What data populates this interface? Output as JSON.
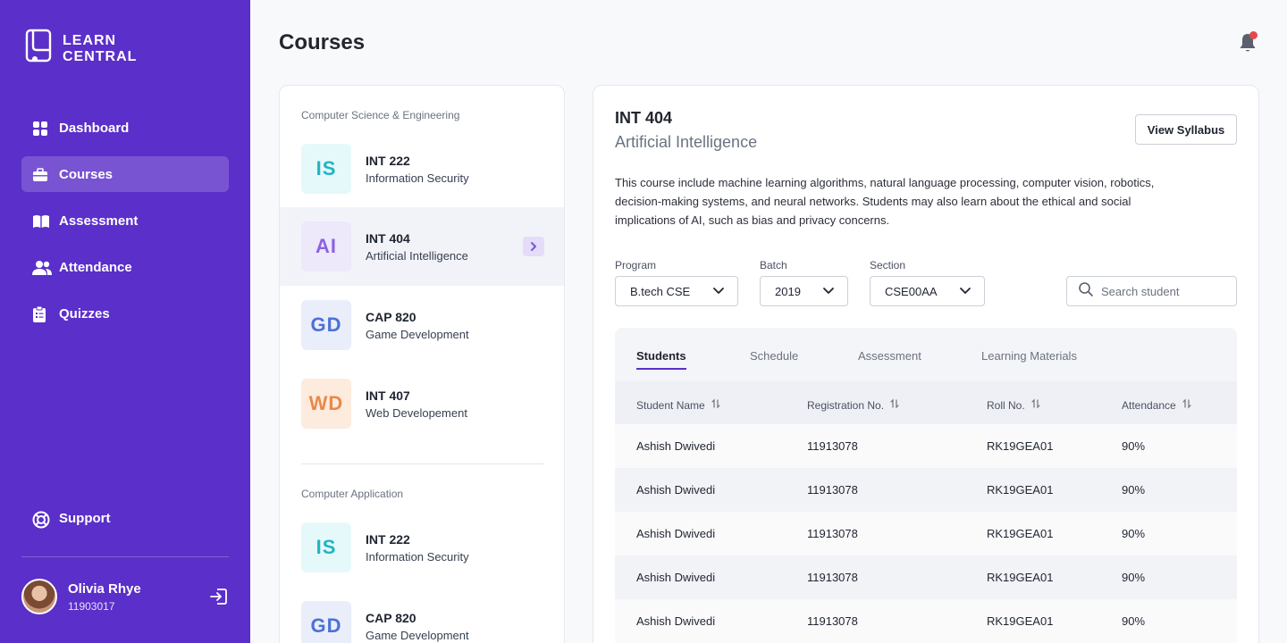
{
  "brand": {
    "line1": "LEARN",
    "line2": "CENTRAL"
  },
  "nav": [
    {
      "label": "Dashboard",
      "icon": "grid-icon"
    },
    {
      "label": "Courses",
      "icon": "briefcase-icon",
      "active": true
    },
    {
      "label": "Assessment",
      "icon": "book-open-icon"
    },
    {
      "label": "Attendance",
      "icon": "users-icon"
    },
    {
      "label": "Quizzes",
      "icon": "clipboard-icon"
    }
  ],
  "support": {
    "label": "Support",
    "icon": "life-buoy-icon"
  },
  "user": {
    "name": "Olivia Rhye",
    "id": "11903017"
  },
  "header": {
    "title": "Courses"
  },
  "course_groups": [
    {
      "label": "Computer Science & Engineering",
      "courses": [
        {
          "badge": "IS",
          "code": "INT 222",
          "name": "Information Security"
        },
        {
          "badge": "AI",
          "code": "INT 404",
          "name": "Artificial Intelligence",
          "selected": true
        },
        {
          "badge": "GD",
          "code": "CAP 820",
          "name": "Game Development"
        },
        {
          "badge": "WD",
          "code": "INT 407",
          "name": "Web Developement"
        }
      ]
    },
    {
      "label": "Computer Application",
      "courses": [
        {
          "badge": "IS",
          "code": "INT 222",
          "name": "Information Security"
        },
        {
          "badge": "GD",
          "code": "CAP 820",
          "name": "Game Development"
        }
      ]
    }
  ],
  "detail": {
    "code": "INT 404",
    "name": "Artificial Intelligence",
    "syllabus_label": "View Syllabus",
    "description": "This course include machine learning algorithms, natural language processing, computer vision, robotics, decision-making systems, and neural networks. Students may also learn about the ethical and social implications of AI, such as bias and privacy concerns.",
    "filters": {
      "program": {
        "label": "Program",
        "value": "B.tech CSE"
      },
      "batch": {
        "label": "Batch",
        "value": "2019"
      },
      "section": {
        "label": "Section",
        "value": "CSE00AA"
      }
    },
    "search_placeholder": "Search student",
    "tabs": [
      "Students",
      "Schedule",
      "Assessment",
      "Learning Materials"
    ],
    "columns": [
      "Student Name",
      "Registration No.",
      "Roll No.",
      "Attendance"
    ],
    "rows": [
      [
        "Ashish Dwivedi",
        "11913078",
        "RK19GEA01",
        "90%"
      ],
      [
        "Ashish Dwivedi",
        "11913078",
        "RK19GEA01",
        "90%"
      ],
      [
        "Ashish Dwivedi",
        "11913078",
        "RK19GEA01",
        "90%"
      ],
      [
        "Ashish Dwivedi",
        "11913078",
        "RK19GEA01",
        "90%"
      ],
      [
        "Ashish Dwivedi",
        "11913078",
        "RK19GEA01",
        "90%"
      ]
    ]
  },
  "colors": {
    "sidebar": "#5B2FC9",
    "accent": "#5B2FC9",
    "notification_dot": "#E5484D"
  }
}
